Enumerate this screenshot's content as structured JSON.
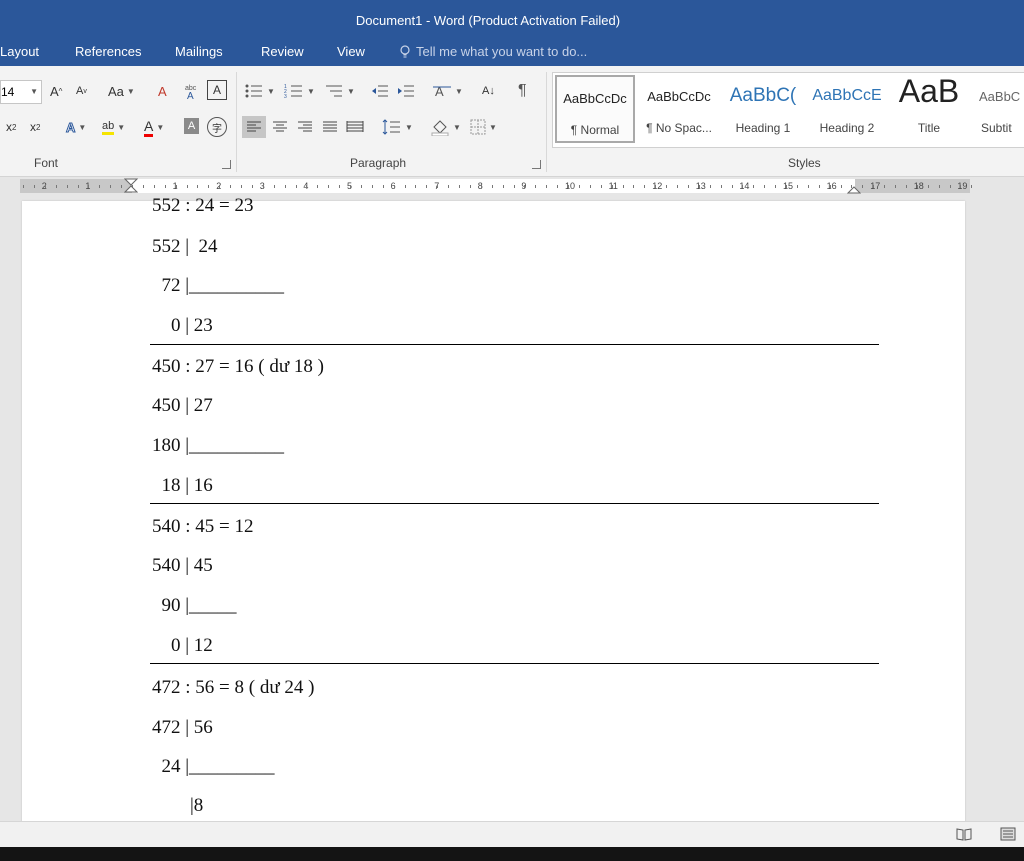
{
  "window": {
    "title": "Document1 - Word (Product Activation Failed)"
  },
  "tabs": [
    "Layout",
    "References",
    "Mailings",
    "Review",
    "View"
  ],
  "tellme": "Tell me what you want to do...",
  "ribbon": {
    "font": {
      "size": "14",
      "grow": "A",
      "shrink": "A",
      "case": "Aa",
      "clear": "A",
      "boxed": "A",
      "subscript": "x",
      "superscript": "x",
      "effects": "A",
      "highlight": "ab",
      "color": "A",
      "shade": "A",
      "enclose": "字",
      "label": "Font"
    },
    "paragraph": {
      "label": "Paragraph",
      "sort": "A↓",
      "pilcrow": "¶"
    },
    "styles": {
      "label": "Styles",
      "items": [
        {
          "sample": "AaBbCcDc",
          "name": "¶ Normal"
        },
        {
          "sample": "AaBbCcDc",
          "name": "¶ No Spac..."
        },
        {
          "sample": "AaBbC(",
          "name": "Heading 1"
        },
        {
          "sample": "AaBbCcE",
          "name": "Heading 2"
        },
        {
          "sample": "AaB",
          "name": "Title"
        },
        {
          "sample": "AaBbC",
          "name": "Subtit"
        }
      ]
    }
  },
  "ruler": {
    "numbers": [
      "2",
      "1",
      "1",
      "2",
      "3",
      "4",
      "5",
      "6",
      "7",
      "8",
      "9",
      "10",
      "11",
      "12",
      "13",
      "14",
      "15",
      "16",
      "17",
      "18",
      "19"
    ]
  },
  "document": {
    "lines": [
      "552 : 24 = 23",
      "552 |  24",
      "  72 |__________",
      "    0 | 23",
      "450 : 27 = 16 ( dư 18 )",
      "450 | 27",
      "180 |__________",
      "  18 | 16",
      "540 : 45 = 12",
      "540 | 45",
      "  90 |_____",
      "    0 | 12",
      "472 : 56 = 8 ( dư 24 )",
      "472 | 56",
      "  24 |_________",
      "        |8"
    ]
  }
}
